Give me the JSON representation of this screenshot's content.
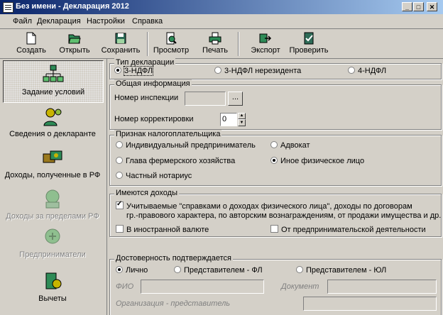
{
  "window": {
    "title": "Без имени - Декларация 2012"
  },
  "menu": [
    "Файл",
    "Декларация",
    "Настройки",
    "Справка"
  ],
  "toolbar": {
    "create": "Создать",
    "open": "Открыть",
    "save": "Сохранить",
    "preview": "Просмотр",
    "print": "Печать",
    "export": "Экспорт",
    "check": "Проверить"
  },
  "nav": {
    "conditions": "Задание условий",
    "declarant": "Сведения о декларанте",
    "income_rf": "Доходы, полученные в РФ",
    "income_abroad": "Доходы за пределами РФ",
    "entrepreneurs": "Предприниматели",
    "deductions": "Вычеты"
  },
  "decl_type": {
    "title": "Тип декларации",
    "options": [
      "3-НДФЛ",
      "3-НДФЛ нерезидента",
      "4-НДФЛ"
    ],
    "selected": "3-НДФЛ"
  },
  "general": {
    "title": "Общая информация",
    "inspection_label": "Номер инспекции",
    "inspection_value": "",
    "browse_button": "...",
    "correction_label": "Номер корректировки",
    "correction_value": "0"
  },
  "taxpayer": {
    "title": "Признак налогоплательщика",
    "options": [
      "Индивидуальный предприниматель",
      "Адвокат",
      "Глава фермерского хозяйства",
      "Иное физическое лицо",
      "Частный нотариус"
    ],
    "selected": "Иное физическое лицо"
  },
  "income": {
    "title": "Имеются доходы",
    "certified_line1": "Учитываемые \"справками о доходах физического лица\", доходы по договорам",
    "certified_line2": "гр.-правового характера, по авторским вознаграждениям, от продажи имущества и др.",
    "certified_checked": true,
    "foreign_currency": "В иностранной валюте",
    "foreign_currency_checked": false,
    "business": "От предпринимательской деятельности",
    "business_checked": false
  },
  "confirm": {
    "title": "Достоверность подтверждается",
    "options": [
      "Лично",
      "Представителем - ФЛ",
      "Представителем - ЮЛ"
    ],
    "selected": "Лично",
    "fio_label": "ФИО",
    "document_label": "Документ",
    "org_label": "Организация - представитель"
  },
  "colors": {
    "titlebar_start": "#0a246a",
    "titlebar_end": "#a6caf0",
    "face": "#d4d0c8"
  }
}
